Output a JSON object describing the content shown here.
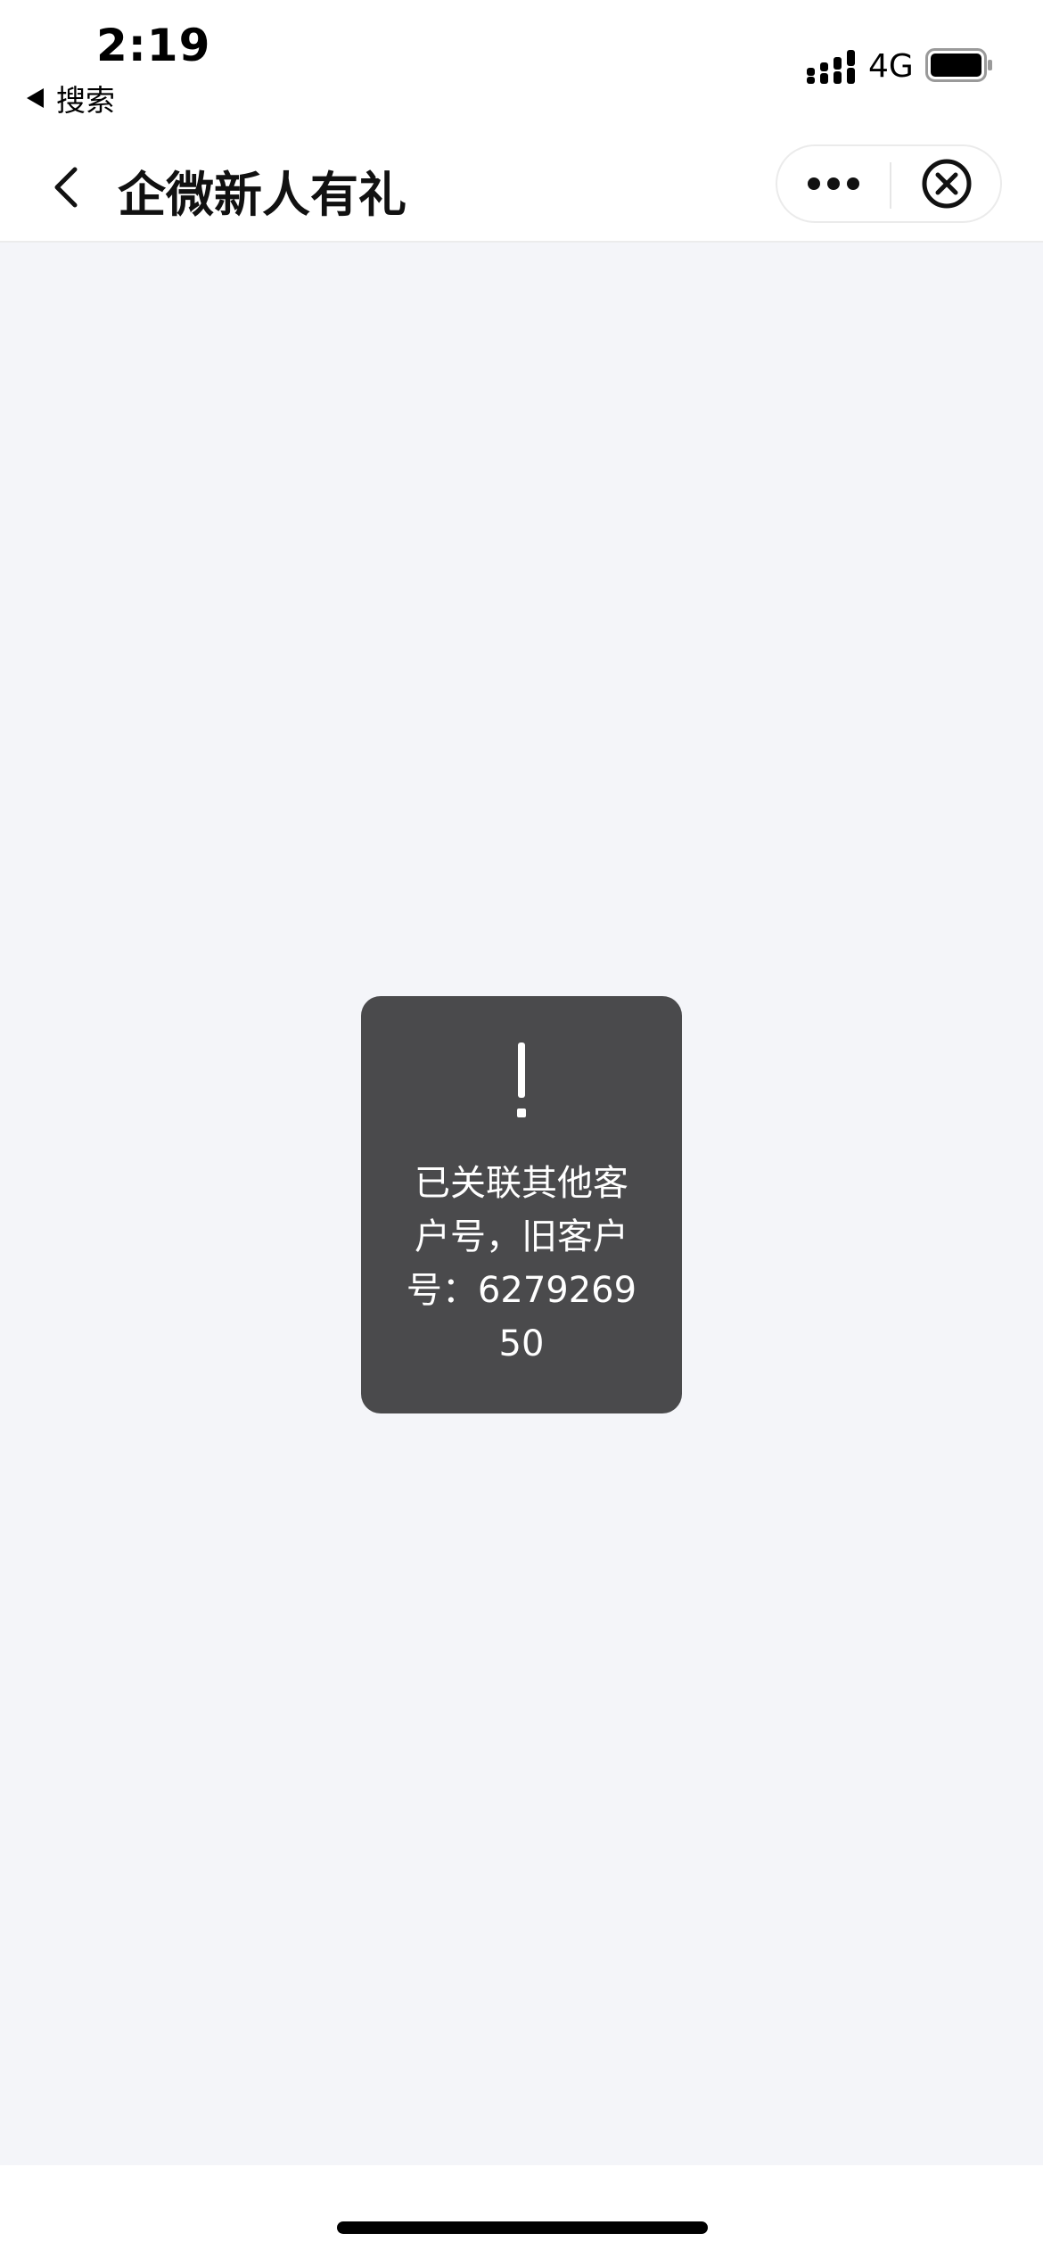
{
  "status_bar": {
    "time": "2:19",
    "back_label": "搜索",
    "network": "4G",
    "icons": {
      "back": "back-triangle-icon",
      "signal": "signal-icon",
      "battery": "battery-icon"
    }
  },
  "nav": {
    "title": "企微新人有礼",
    "icons": {
      "back": "chevron-left-icon",
      "more": "more-dots-icon",
      "close": "close-circle-icon"
    }
  },
  "toast": {
    "icon": "exclamation-icon",
    "message": "已关联其他客户号，旧客户号：627926950"
  },
  "colors": {
    "content_bg": "#f4f5f9",
    "toast_bg": "#4a4a4c",
    "toast_text": "#ffffff"
  }
}
